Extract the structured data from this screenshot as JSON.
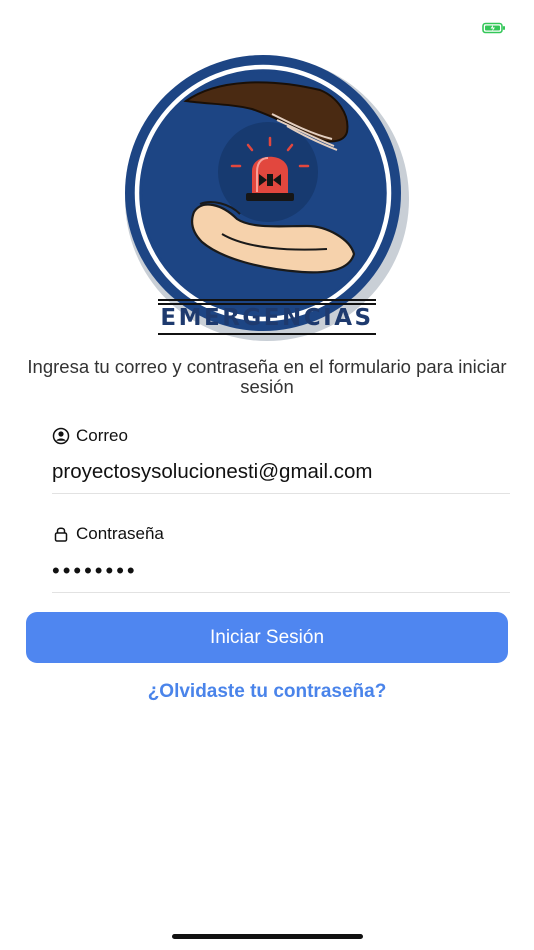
{
  "status_bar": {
    "battery_icon": "battery-icon",
    "battery_color": "#34c759"
  },
  "logo": {
    "text": "EMERGENCIAS",
    "icon": "emergency-siren-hands-icon",
    "color": "#1e3a6e"
  },
  "login": {
    "subtitle": "Ingresa tu correo y contraseña en el formulario para iniciar sesión",
    "email": {
      "label": "Correo",
      "icon": "user-circle-icon",
      "value": "proyectosysolucionesti@gmail.com"
    },
    "password": {
      "label": "Contraseña",
      "icon": "lock-icon",
      "value": "••••••••"
    },
    "submit_label": "Iniciar Sesión",
    "forgot_label": "¿Olvidaste tu contraseña?"
  },
  "colors": {
    "accent": "#4f86f0",
    "link": "#4a84ea"
  }
}
